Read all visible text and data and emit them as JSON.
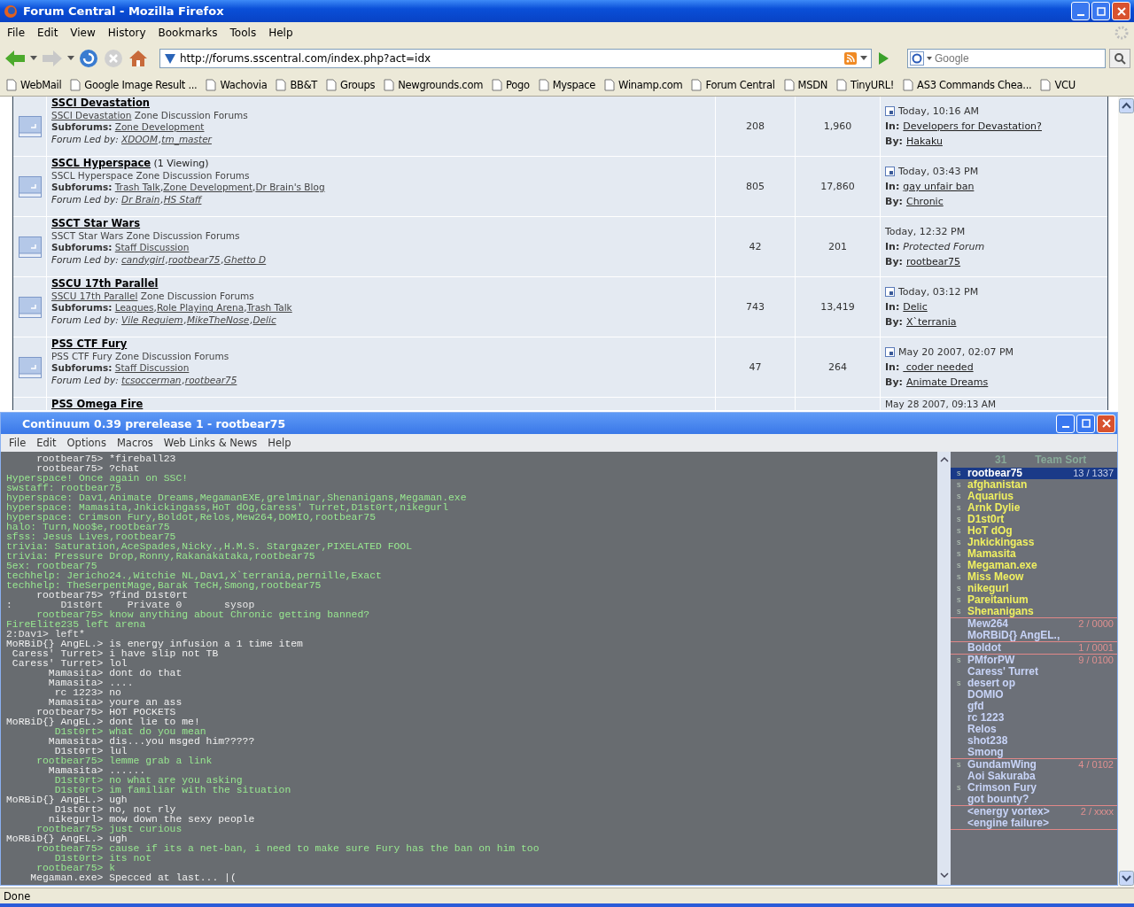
{
  "window": {
    "title": "Forum Central - Mozilla Firefox"
  },
  "menu": [
    "File",
    "Edit",
    "View",
    "History",
    "Bookmarks",
    "Tools",
    "Help"
  ],
  "address": {
    "value": "http://forums.sscentral.com/index.php?act=idx"
  },
  "search": {
    "placeholder": "Google"
  },
  "bookmarks": [
    "WebMail",
    "Google Image Result ...",
    "Wachovia",
    "BB&T",
    "Groups",
    "Newgrounds.com",
    "Pogo",
    "Myspace",
    "Winamp.com",
    "Forum Central",
    "MSDN",
    "TinyURL!",
    "AS3 Commands Chea...",
    "VCU"
  ],
  "forums": [
    {
      "title": "SSCI Devastation",
      "description_link": "SSCI Devastation",
      "description": "Zone Discussion Forums",
      "subforums_label": "Subforums:",
      "subforums": [
        {
          "name": "Zone Development"
        }
      ],
      "leaders_label": "Forum Led by:",
      "leaders": [
        {
          "name": "XDOOM",
          "sep": ","
        },
        {
          "name": "tm_master"
        }
      ],
      "topics": "208",
      "replies": "1,960",
      "last_post": {
        "new": true,
        "date": "Today, 10:16 AM",
        "in_label": "In:",
        "in": "Developers for Devastation?",
        "protected": false,
        "by_label": "By:",
        "by": "Hakaku"
      }
    },
    {
      "title": "SSCL Hyperspace",
      "viewing": "(1 Viewing)",
      "description": "SSCL Hyperspace Zone Discussion Forums",
      "subforums_label": "Subforums:",
      "subforums": [
        {
          "name": "Trash Talk",
          "sep": ","
        },
        {
          "name": "Zone Development",
          "sep": ","
        },
        {
          "name": "Dr Brain's Blog"
        }
      ],
      "leaders_label": "Forum Led by:",
      "leaders": [
        {
          "name": "Dr Brain",
          "sep": ","
        },
        {
          "name": "HS Staff"
        }
      ],
      "topics": "805",
      "replies": "17,860",
      "last_post": {
        "new": true,
        "date": "Today, 03:43 PM",
        "in_label": "In:",
        "in": "gay unfair ban",
        "protected": false,
        "by_label": "By:",
        "by": "Chronic"
      }
    },
    {
      "title": "SSCT Star Wars",
      "description": "SSCT Star Wars Zone Discussion Forums",
      "subforums_label": "Subforums:",
      "subforums": [
        {
          "name": "Staff Discussion"
        }
      ],
      "leaders_label": "Forum Led by:",
      "leaders": [
        {
          "name": "candygirl",
          "sep": ","
        },
        {
          "name": "rootbear75",
          "sep": ","
        },
        {
          "name": "Ghetto D"
        }
      ],
      "topics": "42",
      "replies": "201",
      "last_post": {
        "new": false,
        "date": "Today, 12:32 PM",
        "in_label": "In:",
        "in": "Protected Forum",
        "protected": true,
        "by_label": "By:",
        "by": "rootbear75"
      }
    },
    {
      "title": "SSCU 17th Parallel",
      "description_link": "SSCU 17th Parallel",
      "description": "Zone Discussion Forums",
      "subforums_label": "Subforums:",
      "subforums": [
        {
          "name": "Leagues",
          "sep": ","
        },
        {
          "name": "Role Playing Arena",
          "sep": ","
        },
        {
          "name": "Trash Talk"
        }
      ],
      "leaders_label": "Forum Led by:",
      "leaders": [
        {
          "name": "Vile Requiem",
          "sep": ","
        },
        {
          "name": "MikeTheNose",
          "sep": ","
        },
        {
          "name": "Delic"
        }
      ],
      "topics": "743",
      "replies": "13,419",
      "last_post": {
        "new": true,
        "date": "Today, 03:12 PM",
        "in_label": "In:",
        "in": "Delic",
        "protected": false,
        "by_label": "By:",
        "by": "X`terrania"
      }
    },
    {
      "title": "PSS CTF Fury",
      "description": "PSS CTF Fury Zone Discussion Forums",
      "subforums_label": "Subforums:",
      "subforums": [
        {
          "name": "Staff Discussion"
        }
      ],
      "leaders_label": "Forum Led by:",
      "leaders": [
        {
          "name": "tcsoccerman",
          "sep": ","
        },
        {
          "name": "rootbear75"
        }
      ],
      "topics": "47",
      "replies": "264",
      "last_post": {
        "new": true,
        "date": "May 20 2007, 02:07 PM",
        "in_label": "In:",
        "in": " coder needed",
        "protected": false,
        "by_label": "By:",
        "by": "Animate Dreams"
      }
    }
  ],
  "partial_forum": {
    "title": "PSS Omega Fire",
    "date": "May 28 2007, 09:13 AM"
  },
  "game": {
    "title": "Continuum 0.39 prerelease 1 - rootbear75",
    "menu": [
      "File",
      "Edit",
      "Options",
      "Macros",
      "Web Links & News",
      "Help"
    ],
    "chat": [
      {
        "kind": "public",
        "name": "rootbear75>",
        "text": "*fireball23"
      },
      {
        "kind": "public",
        "name": "rootbear75>",
        "text": "?chat"
      },
      {
        "kind": "system",
        "text": "Hyperspace! Once again on SSC!"
      },
      {
        "kind": "system",
        "text": "swstaff: rootbear75"
      },
      {
        "kind": "system",
        "text": "hyperspace: Dav1,Animate Dreams,MegamanEXE,grelminar,Shenanigans,Megaman.exe"
      },
      {
        "kind": "system",
        "text": "hyperspace: Mamasita,Jnkickingass,HoT dOg,Caress' Turret,D1st0rt,nikegurl"
      },
      {
        "kind": "system",
        "text": "hyperspace: Crimson Fury,Boldot,Relos,Mew264,DOMIO,rootbear75"
      },
      {
        "kind": "system",
        "text": "halo: Turn,Noo$e,rootbear75"
      },
      {
        "kind": "system",
        "text": "sfss: Jesus Lives,rootbear75"
      },
      {
        "kind": "system",
        "text": "trivia: Saturation,AceSpades,Nicky.,H.M.S. Stargazer,PIXELATED FOOL"
      },
      {
        "kind": "system",
        "text": "trivia: Pressure Drop,Ronny,Rakanakataka,rootbear75"
      },
      {
        "kind": "system",
        "text": "5ex: rootbear75"
      },
      {
        "kind": "system",
        "text": "techhelp: Jericho24.,Witchie NL,Dav1,X`terrania,pernille,Exact"
      },
      {
        "kind": "system",
        "text": "techhelp: TheSerpentMage,Barak TeCH,Smong,rootbear75"
      },
      {
        "kind": "public",
        "name": "rootbear75>",
        "text": "?find D1st0rt"
      },
      {
        "kind": "channel",
        "text": ":        D1st0rt    Private 0       sysop"
      },
      {
        "kind": "private",
        "name": "rootbear75>",
        "text": "know anything about Chronic getting banned?"
      },
      {
        "kind": "system",
        "text": "FireElite235 left arena"
      },
      {
        "kind": "channel",
        "text": "2:Dav1> left*"
      },
      {
        "kind": "public",
        "name": "MoRBiD{} AngEL.>",
        "text": "is energy infusion a 1 time item"
      },
      {
        "kind": "public",
        "name": "Caress' Turret>",
        "text": "i have slip not TB"
      },
      {
        "kind": "public",
        "name": "Caress' Turret>",
        "text": "lol"
      },
      {
        "kind": "public",
        "name": "Mamasita>",
        "text": "dont do that"
      },
      {
        "kind": "public",
        "name": "Mamasita>",
        "text": "...."
      },
      {
        "kind": "public",
        "name": "rc 1223>",
        "text": "no"
      },
      {
        "kind": "public",
        "name": "Mamasita>",
        "text": "youre an ass"
      },
      {
        "kind": "public",
        "name": "rootbear75>",
        "text": "HOT POCKETS"
      },
      {
        "kind": "public",
        "name": "MoRBiD{} AngEL.>",
        "text": "dont lie to me!"
      },
      {
        "kind": "private",
        "name": "D1st0rt>",
        "text": "what do you mean"
      },
      {
        "kind": "public",
        "name": "Mamasita>",
        "text": "dis...you msged him?????"
      },
      {
        "kind": "public",
        "name": "D1st0rt>",
        "text": "lul"
      },
      {
        "kind": "private",
        "name": "rootbear75>",
        "text": "lemme grab a link"
      },
      {
        "kind": "public",
        "name": "Mamasita>",
        "text": "......"
      },
      {
        "kind": "private",
        "name": "D1st0rt>",
        "text": "no what are you asking"
      },
      {
        "kind": "private",
        "name": "D1st0rt>",
        "text": "im familiar with the situation"
      },
      {
        "kind": "public",
        "name": "MoRBiD{} AngEL.>",
        "text": "ugh"
      },
      {
        "kind": "public",
        "name": "D1st0rt>",
        "text": "no, not rly"
      },
      {
        "kind": "public",
        "name": "nikegurl>",
        "text": "mow down the sexy people"
      },
      {
        "kind": "private",
        "name": "rootbear75>",
        "text": "just curious"
      },
      {
        "kind": "public",
        "name": "MoRBiD{} AngEL.>",
        "text": "ugh"
      },
      {
        "kind": "private",
        "name": "rootbear75>",
        "text": "cause if its a net-ban, i need to make sure Fury has the ban on him too"
      },
      {
        "kind": "private",
        "name": "D1st0rt>",
        "text": "its not"
      },
      {
        "kind": "private",
        "name": "rootbear75>",
        "text": "k"
      },
      {
        "kind": "public",
        "name": "Megaman.exe>",
        "text": "Specced at last... |("
      }
    ],
    "player_count": "31",
    "sort": "Team Sort",
    "teams": [
      {
        "freq": "13 / 1337",
        "color": "#f0f060",
        "players": [
          {
            "name": "rootbear75",
            "tag": "s",
            "selected": true
          },
          {
            "name": "afghanistan",
            "tag": "s",
            "selected": false
          },
          {
            "name": "Aquarius",
            "tag": "s",
            "selected": false
          },
          {
            "name": "Arnk Dylie",
            "tag": "s",
            "selected": false
          },
          {
            "name": "D1st0rt",
            "tag": "s",
            "selected": false
          },
          {
            "name": "HoT dOg",
            "tag": "s",
            "selected": false
          },
          {
            "name": "Jnkickingass",
            "tag": "s",
            "selected": false
          },
          {
            "name": "Mamasita",
            "tag": "s",
            "selected": false
          },
          {
            "name": "Megaman.exe",
            "tag": "s",
            "selected": false
          },
          {
            "name": "Miss Meow",
            "tag": "s",
            "selected": false
          },
          {
            "name": "nikegurl",
            "tag": "s",
            "selected": false
          },
          {
            "name": "Pareitanium",
            "tag": "s",
            "selected": false
          },
          {
            "name": "Shenanigans",
            "tag": "s",
            "selected": false
          }
        ]
      },
      {
        "freq": "2 / 0000",
        "color": "#c8d4f8",
        "players": [
          {
            "name": "Mew264",
            "selected": false
          },
          {
            "name": "MoRBiD{} AngEL.,",
            "selected": false
          }
        ]
      },
      {
        "freq": "1 / 0001",
        "color": "#c8d4f8",
        "players": [
          {
            "name": "Boldot",
            "selected": false
          }
        ]
      },
      {
        "freq": "9 / 0100",
        "color": "#c8d4f8",
        "players": [
          {
            "name": "PMforPW",
            "tag": "s",
            "selected": false
          },
          {
            "name": "Caress' Turret",
            "selected": false
          },
          {
            "name": "desert op",
            "tag": "s",
            "selected": false
          },
          {
            "name": "DOMIO",
            "selected": false
          },
          {
            "name": "gfd",
            "selected": false
          },
          {
            "name": "rc 1223",
            "selected": false
          },
          {
            "name": "Relos",
            "selected": false
          },
          {
            "name": "shot238",
            "selected": false
          },
          {
            "name": "Smong",
            "selected": false
          }
        ]
      },
      {
        "freq": "4 / 0102",
        "color": "#c8d4f8",
        "players": [
          {
            "name": "GundamWing",
            "tag": "s",
            "selected": false
          },
          {
            "name": "Aoi Sakuraba",
            "selected": false
          },
          {
            "name": "Crimson Fury",
            "tag": "s",
            "selected": false
          },
          {
            "name": "got bounty?",
            "selected": false
          }
        ]
      },
      {
        "freq": "2 / xxxx",
        "color": "#c8d4f8",
        "players": [
          {
            "name": "<energy vortex>",
            "selected": false
          },
          {
            "name": "<engine failure>",
            "selected": false
          }
        ]
      }
    ]
  },
  "status_bar": "Done"
}
